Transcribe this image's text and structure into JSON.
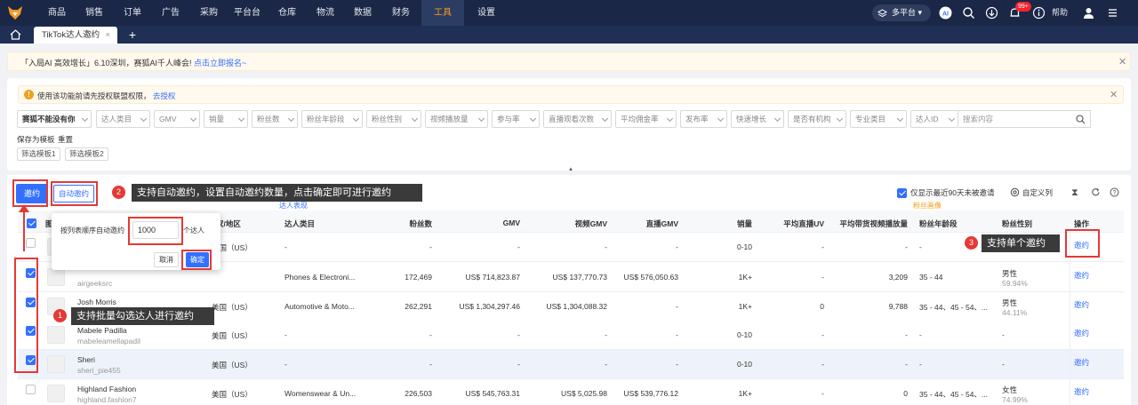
{
  "nav": {
    "items": [
      "商品",
      "销售",
      "订单",
      "广告",
      "采购",
      "平台台",
      "仓库",
      "物流",
      "数据",
      "财务",
      "工具",
      "设置"
    ],
    "active": "工具",
    "platform": "多平台",
    "badge": "99+",
    "help": "帮助",
    "ai_label": "AI"
  },
  "tabs": {
    "current": "TikTok达人邀约",
    "close": "×",
    "add": "+"
  },
  "banner1": {
    "text": "「入局AI 高效增长」6.10深圳，赛狐AI千人峰会! ",
    "link": "点击立即报名~"
  },
  "banner2": {
    "text": "使用该功能前请先授权联盟权限， ",
    "link": "去授权",
    "icon": "!"
  },
  "filters": {
    "selects": [
      "赛狐不能没有你",
      "达人类目",
      "GMV",
      "销量",
      "粉丝数",
      "粉丝年龄段",
      "粉丝性别",
      "视频播放量",
      "参与率",
      "直播观看次数",
      "平均佣金率",
      "发布率",
      "快速增长",
      "是否有机构",
      "专业类目",
      "达人ID"
    ],
    "search_placeholder": "搜索内容",
    "save_template": "保存为模板",
    "reset": "重置",
    "templates": [
      "筛选模板1",
      "筛选模板2"
    ]
  },
  "toolbar": {
    "invite": "邀约",
    "auto_invite": "自动邀约",
    "only_90": "仅显示最近90天未被邀请",
    "custom_columns": "自定义列",
    "sub_link_1": "达人表现",
    "sub_link_2": "粉丝画像"
  },
  "table": {
    "headers": {
      "image": "图",
      "region": "家/地区",
      "category": "达人类目",
      "fans": "粉丝数",
      "gmv": "GMV",
      "video_gmv": "视频GMV",
      "live_gmv": "直播GMV",
      "sales": "销量",
      "avg_live_uv": "平均直播UV",
      "avg_video_play": "平均带货视频播放量",
      "fan_age": "粉丝年龄段",
      "fan_gender": "粉丝性别",
      "action": "操作"
    },
    "rows": [
      {
        "name": "",
        "handle": "",
        "region": "美国（US）",
        "category": "-",
        "fans": "-",
        "gmv": "-",
        "video_gmv": "-",
        "live_gmv": "-",
        "sales": "0-10",
        "avg_live_uv": "-",
        "avg_video_play": "-",
        "fan_age": "-",
        "fan_gender": "",
        "fan_pct": "",
        "action": "邀约",
        "checked": false
      },
      {
        "name": "",
        "handle": "airgeeksrc",
        "region": "",
        "category": "Phones & Electroni...",
        "fans": "172,469",
        "gmv": "US$ 714,823.87",
        "video_gmv": "US$ 137,770.73",
        "live_gmv": "US$ 576,050.63",
        "sales": "1K+",
        "avg_live_uv": "-",
        "avg_video_play": "3,209",
        "fan_age": "35 - 44",
        "fan_gender": "男性",
        "fan_pct": "59.94%",
        "action": "邀约",
        "checked": true
      },
      {
        "name": "Josh Morris",
        "handle": "",
        "region": "美国（US）",
        "category": "Automotive & Moto...",
        "fans": "262,291",
        "gmv": "US$ 1,304,297.46",
        "video_gmv": "US$ 1,304,088.32",
        "live_gmv": "-",
        "sales": "1K+",
        "avg_live_uv": "0",
        "avg_video_play": "9,788",
        "fan_age": "35 - 44、45 - 54、...",
        "fan_gender": "男性",
        "fan_pct": "44.11%",
        "action": "邀约",
        "checked": true
      },
      {
        "name": "Mabele Padilla",
        "handle": "mabeleamellapadil",
        "region": "美国（US）",
        "category": "-",
        "fans": "-",
        "gmv": "-",
        "video_gmv": "-",
        "live_gmv": "-",
        "sales": "0-10",
        "avg_live_uv": "-",
        "avg_video_play": "-",
        "fan_age": "-",
        "fan_gender": "-",
        "fan_pct": "",
        "action": "邀约",
        "checked": true
      },
      {
        "name": "Sheri",
        "handle": "sheri_pie455",
        "region": "美国（US）",
        "category": "-",
        "fans": "-",
        "gmv": "-",
        "video_gmv": "-",
        "live_gmv": "-",
        "sales": "0-10",
        "avg_live_uv": "-",
        "avg_video_play": "-",
        "fan_age": "-",
        "fan_gender": "-",
        "fan_pct": "",
        "action": "邀约",
        "checked": true
      },
      {
        "name": "Highland Fashion",
        "handle": "highland.fashion7",
        "region": "美国（US）",
        "category": "Womenswear & Un...",
        "fans": "226,503",
        "gmv": "US$ 545,763.31",
        "video_gmv": "US$ 5,025.98",
        "live_gmv": "US$ 539,776.12",
        "sales": "1K+",
        "avg_live_uv": "-",
        "avg_video_play": "0",
        "fan_age": "35 - 44、45 - 54、...",
        "fan_gender": "女性",
        "fan_pct": "74.99%",
        "action": "邀约",
        "checked": false
      }
    ]
  },
  "popup": {
    "label": "按列表顺序自动邀约",
    "value": "1000",
    "unit": "个达人",
    "cancel": "取消",
    "ok": "确定"
  },
  "annotations": {
    "tip1": "支持批量勾选达人进行邀约",
    "tip2": "支持自动邀约，设置自动邀约数量，点击确定即可进行邀约",
    "tip3": "支持单个邀约",
    "n1": "1",
    "n2": "2",
    "n3": "3"
  },
  "colors": {
    "nav_bg": "#1a2746",
    "accent": "#3370ff",
    "active_nav": "#ff9a1a",
    "annotation_red": "#e53935"
  }
}
